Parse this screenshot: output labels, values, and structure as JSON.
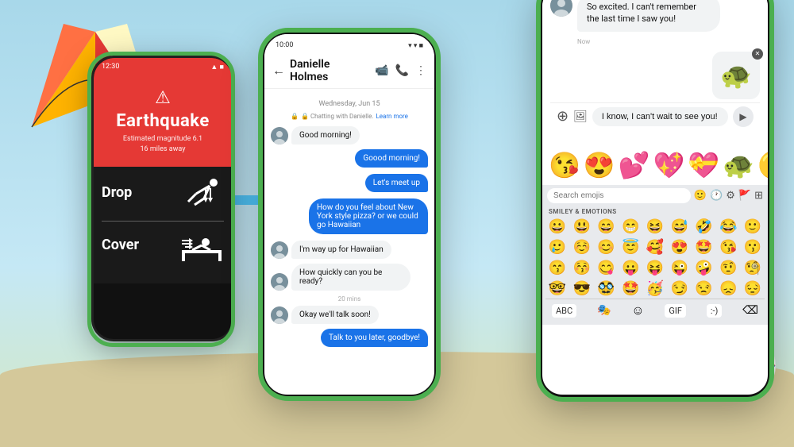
{
  "background": {
    "sky_color": "#b8e8f5",
    "sand_color": "#d4c89a"
  },
  "phone_left": {
    "status_bar": {
      "time": "12:30",
      "signal": "▲▲▲",
      "wifi": "▾",
      "battery": "■"
    },
    "alert": {
      "icon": "⚠",
      "title": "Earthquake",
      "line1": "Estimated magnitude 6.1",
      "line2": "16 miles away"
    },
    "instructions": [
      {
        "label": "Drop",
        "icon": "🧎"
      },
      {
        "label": "Cover",
        "icon": "🧎"
      }
    ]
  },
  "phone_middle": {
    "status_bar": {
      "time": "10:00",
      "signal": "▾▾",
      "battery": "■"
    },
    "header": {
      "back_icon": "←",
      "contact": "Danielle Holmes",
      "video_icon": "📹",
      "call_icon": "📞",
      "menu_icon": "⋮"
    },
    "date_label": "Wednesday, Jun 15",
    "secure_label": "🔒 Chatting with Danielle.",
    "learn_more": "Learn more",
    "messages": [
      {
        "type": "received",
        "text": "Good morning!",
        "has_avatar": true
      },
      {
        "type": "sent",
        "text": "Goood morning!"
      },
      {
        "type": "sent",
        "text": "Let's meet up"
      },
      {
        "type": "sent",
        "text": "How do you feel about New York style pizza? or we could go Hawaiian"
      },
      {
        "type": "received",
        "text": "I'm way up for Hawaiian",
        "has_avatar": true
      },
      {
        "type": "received",
        "text": "How quickly can you be ready?",
        "has_avatar": true
      },
      {
        "type": "time",
        "text": "20 mins"
      },
      {
        "type": "received",
        "text": "Okay we'll talk soon!",
        "has_avatar": true
      },
      {
        "type": "sent",
        "text": "Talk to you later, goodbye!"
      }
    ]
  },
  "phone_right": {
    "chat": {
      "received_text": "So excited. I can't remember the last time I saw you!",
      "time": "Now",
      "turtle_emoji": "🐢",
      "input_text": "I know, I can't wait to see you!"
    },
    "stickers": [
      "😘",
      "😍",
      "💕",
      "💖",
      "💝",
      "🐢",
      "🟡"
    ],
    "keyboard": {
      "search_placeholder": "Search emojis",
      "category": "SMILEY & EMOTIONS",
      "emojis_row1": [
        "😀",
        "😃",
        "😄",
        "😁",
        "😆",
        "😅",
        "🤣",
        "😂",
        "🙂"
      ],
      "emojis_row2": [
        "🥲",
        "☺️",
        "😊",
        "😇",
        "🥰",
        "😍",
        "🤩",
        "😘",
        "😗"
      ],
      "emojis_row3": [
        "😙",
        "😚",
        "😋",
        "😛",
        "😝",
        "😜",
        "🤪",
        "🤨",
        "🧐"
      ],
      "emojis_row4": [
        "🤓",
        "😎",
        "🥸",
        "🤩",
        "🥳",
        "😏",
        "😒",
        "😞",
        "😔"
      ],
      "bottom_bar": {
        "abc": "ABC",
        "sticker": "🎭",
        "emoji": "☺",
        "gif": "GIF",
        "action": ":-)",
        "backspace": "⌫"
      }
    }
  }
}
